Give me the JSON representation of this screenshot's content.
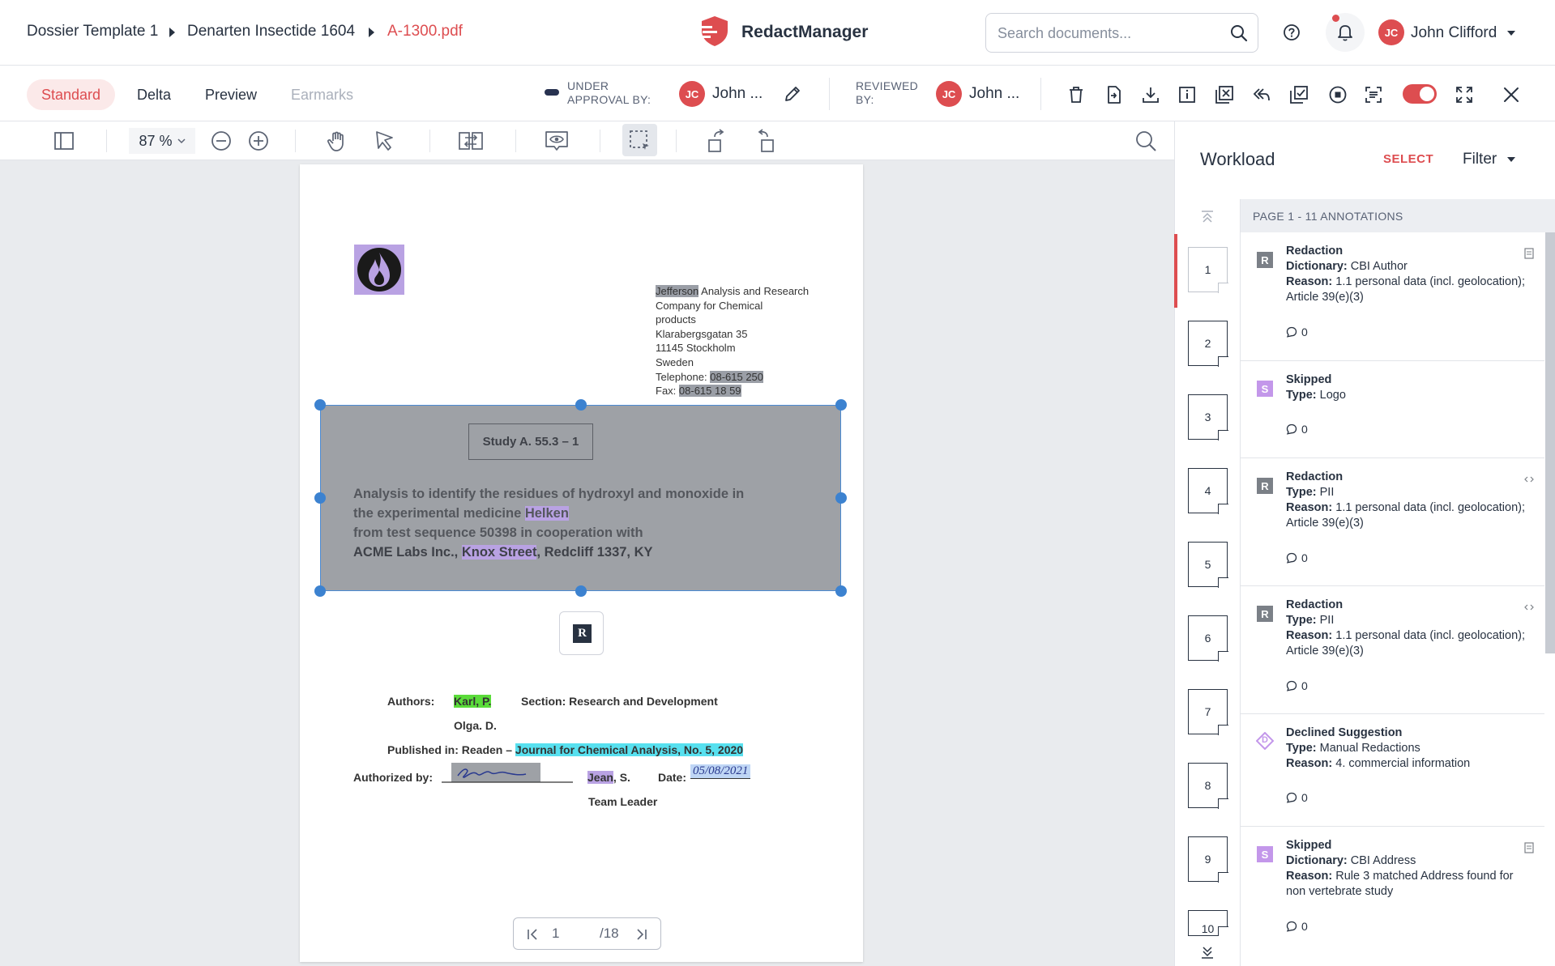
{
  "breadcrumb": {
    "template": "Dossier Template 1",
    "dossier": "Denarten Insectide 1604",
    "file": "A-1300.pdf"
  },
  "app": {
    "name": "RedactManager"
  },
  "search": {
    "placeholder": "Search documents..."
  },
  "user": {
    "initials": "JC",
    "name": "John Clifford"
  },
  "tabs": [
    {
      "label": "Standard",
      "state": "active"
    },
    {
      "label": "Delta",
      "state": "normal"
    },
    {
      "label": "Preview",
      "state": "normal"
    },
    {
      "label": "Earmarks",
      "state": "disabled"
    }
  ],
  "approval": {
    "label_line1": "UNDER",
    "label_line2": "APPROVAL BY:",
    "initials": "JC",
    "name": "John ..."
  },
  "reviewed": {
    "label_line1": "REVIEWED",
    "label_line2": "BY:",
    "initials": "JC",
    "name": "John ..."
  },
  "viewer": {
    "zoom": "87 %"
  },
  "document": {
    "address": {
      "company_name": "Jefferson",
      "line1_rest": " Analysis and Research",
      "line2": "Company for Chemical",
      "line3": "products",
      "street": "Klarabergsgatan 35",
      "city": "11145 Stockholm",
      "country": "Sweden",
      "phone_label": "Telephone: ",
      "phone": "08-615 250",
      "fax_label": "Fax: ",
      "fax": "08-615 18 59"
    },
    "study": "Study A. 55.3 – 1",
    "title": {
      "line1": "Analysis to identify the residues of hydroxyl and monoxide in",
      "line2_pre": "the experimental medicine ",
      "line2_hl": "Helken",
      "line3": "from test sequence 50398 in cooperation with",
      "line4_pre": "ACME Labs Inc., ",
      "line4_hl": "Knox Street",
      "line4_post": ", Redcliff 1337, KY"
    },
    "redaction_badge": "R",
    "authors_label": "Authors:",
    "author1": "Karl, P.",
    "section": "Section: Research and Development",
    "author2": "Olga. D.",
    "published_pre": "Published in: Readen – ",
    "journal": "Journal for Chemical Analysis, No. 5, 2020",
    "authorized_label": "Authorized by:",
    "signer_hl": "Jean",
    "signer_rest": ", S.",
    "date_label": "Date:",
    "date_value": "05/08/2021",
    "role": "Team Leader"
  },
  "pager": {
    "current": "1",
    "total": "/18"
  },
  "workload": {
    "title": "Workload",
    "select_label": "SELECT",
    "filter_label": "Filter",
    "page_header": "PAGE 1 - 11 ANNOTATIONS",
    "pages": [
      "1",
      "2",
      "3",
      "4",
      "5",
      "6",
      "7",
      "8",
      "9",
      "10"
    ],
    "annotations": [
      {
        "badge": "R",
        "badge_color": "#7b8087",
        "title": "Redaction",
        "k1": "Dictionary: ",
        "v1": "CBI Author",
        "k2": "Reason: ",
        "v2": "1.1 personal data (incl. geolocation); Article 39(e)(3)",
        "comments": "0",
        "corner": "document-icon"
      },
      {
        "badge": "S",
        "badge_color": "#c397ea",
        "title": "Skipped",
        "k1": "Type: ",
        "v1": "Logo",
        "k2": "",
        "v2": "",
        "comments": "0",
        "corner": ""
      },
      {
        "badge": "R",
        "badge_color": "#7b8087",
        "title": "Redaction",
        "k1": "Type: ",
        "v1": "PII",
        "k2": "Reason: ",
        "v2": "1.1 personal data (incl. geolocation); Article 39(e)(3)",
        "comments": "0",
        "corner": "code-icon"
      },
      {
        "badge": "R",
        "badge_color": "#7b8087",
        "title": "Redaction",
        "k1": "Type: ",
        "v1": "PII",
        "k2": "Reason: ",
        "v2": "1.1 personal data (incl. geolocation); Article 39(e)(3)",
        "comments": "0",
        "corner": "code-icon"
      },
      {
        "badge": "D",
        "badge_color": "#c397ea",
        "title": "Declined Suggestion",
        "k1": "Type: ",
        "v1": "Manual Redactions",
        "k2": "Reason: ",
        "v2": "4. commercial information",
        "comments": "0",
        "corner": ""
      },
      {
        "badge": "S",
        "badge_color": "#c397ea",
        "title": "Skipped",
        "k1": "Dictionary: ",
        "v1": "CBI Address",
        "k2": "Reason: ",
        "v2": "Rule 3 matched Address found for non vertebrate study",
        "comments": "0",
        "corner": "document-icon"
      }
    ]
  },
  "colors": {
    "accent": "#dd4d50",
    "text": "#283241",
    "viewer_bg": "#e9ebee",
    "selection": "#3c82d0"
  }
}
